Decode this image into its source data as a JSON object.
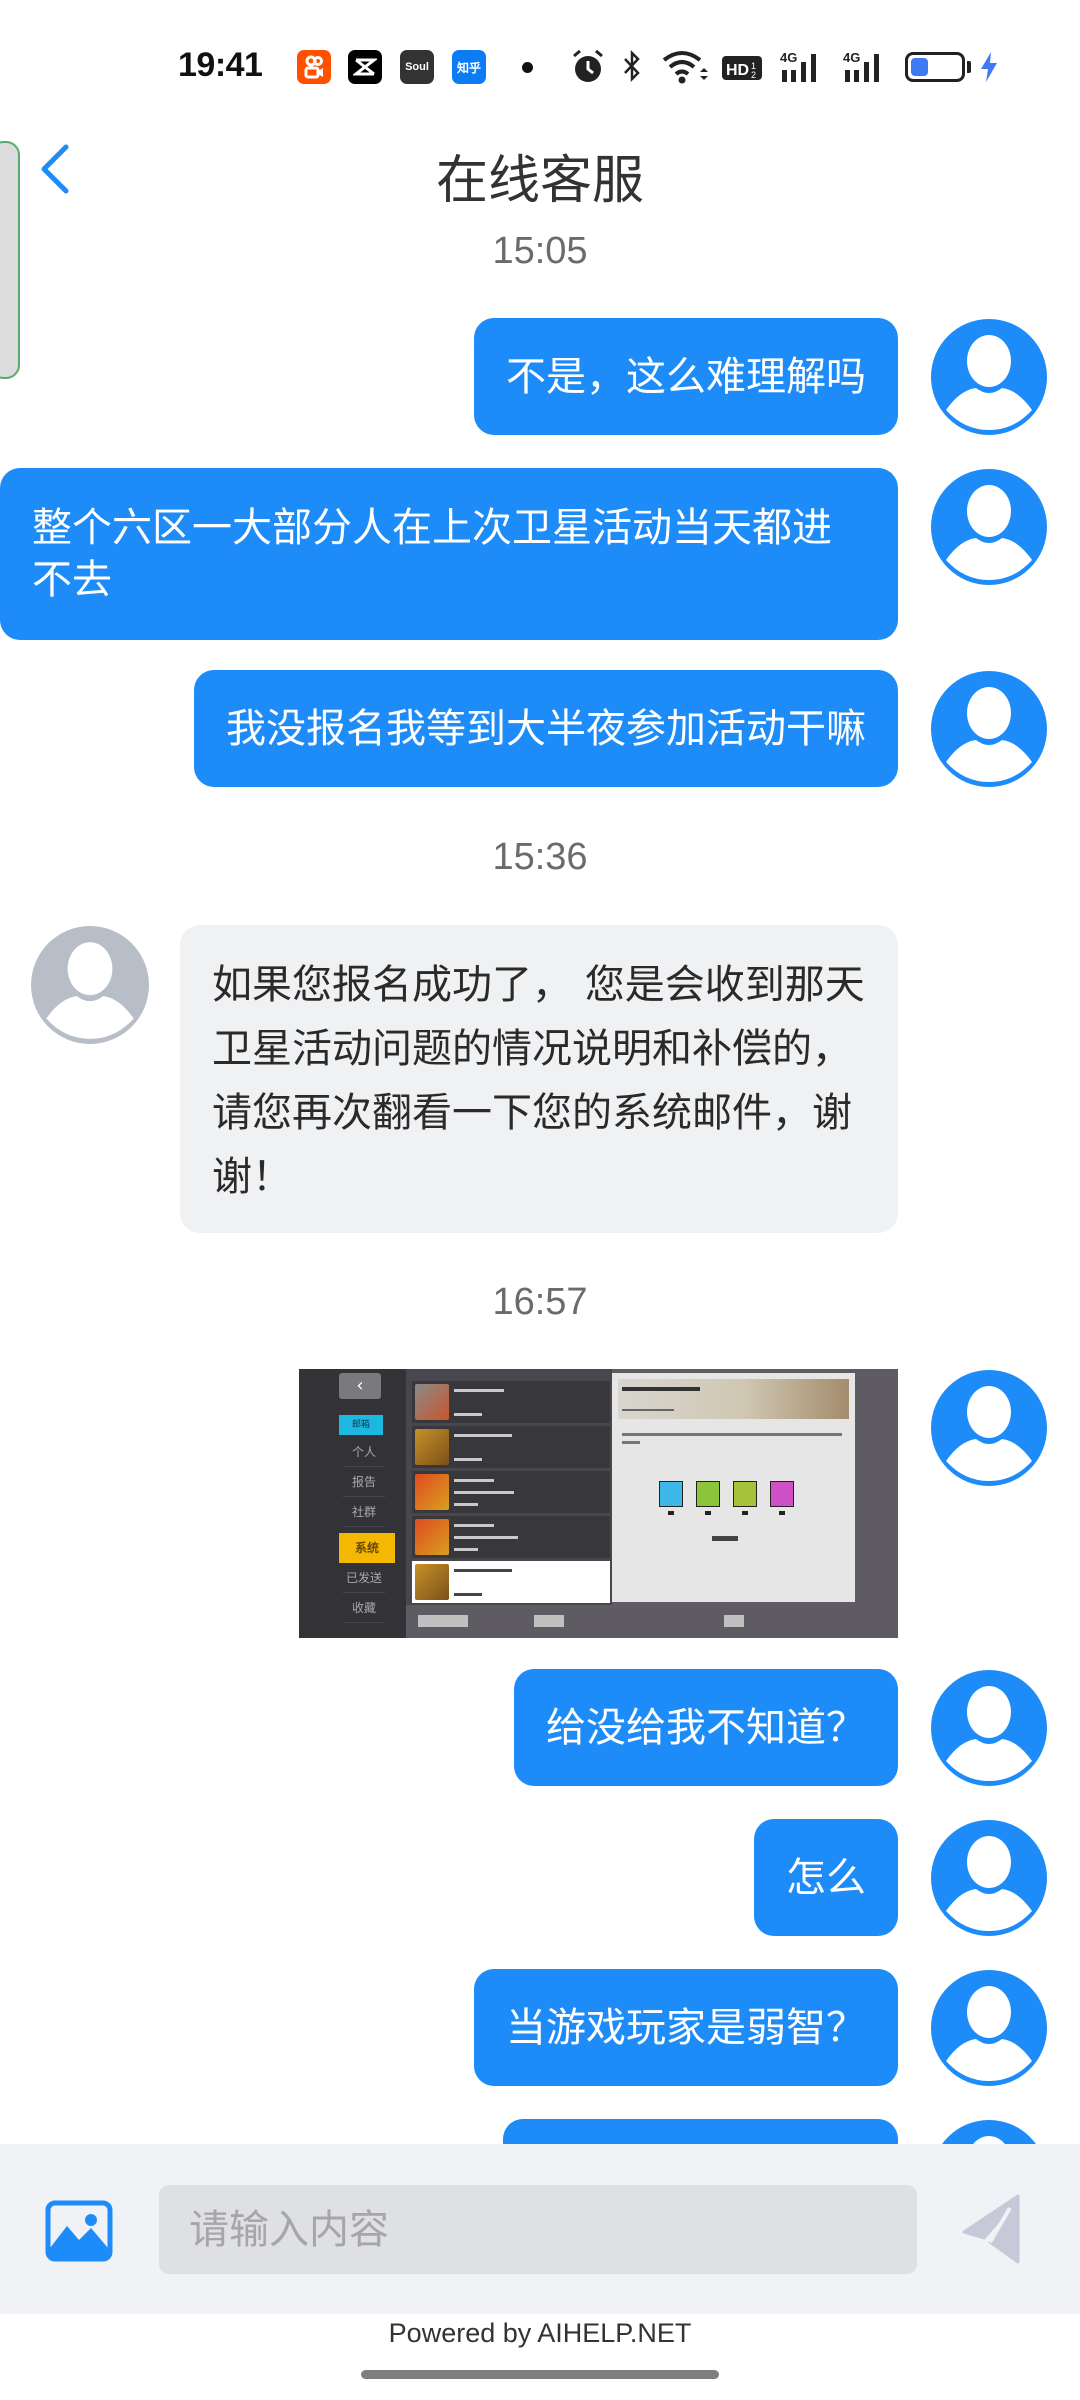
{
  "status_bar": {
    "time": "19:41",
    "apps": [
      {
        "name": "kuaishou",
        "label": "8"
      },
      {
        "name": "capcut",
        "label": "✕"
      },
      {
        "name": "soul",
        "label": "Soul"
      },
      {
        "name": "zhihu",
        "label": "知乎"
      }
    ],
    "icons": [
      "notification-dot",
      "alarm-icon",
      "bluetooth-icon",
      "wifi-icon",
      "hd-icon",
      "signal-4g-icon",
      "signal-4g-icon",
      "battery-icon",
      "charging-icon"
    ],
    "hd_label": "HD",
    "network_label": "4G",
    "battery_level": 0.35,
    "accent": "#3E7BF2"
  },
  "header": {
    "title": "在线客服",
    "back_icon": "chevron-left-icon",
    "accent": "#1E8CF8"
  },
  "conversation": {
    "timestamps": [
      "15:05",
      "15:36",
      "16:57"
    ],
    "messages": [
      {
        "sender": "user",
        "text": "不是，这么难理解吗"
      },
      {
        "sender": "user",
        "text": "整个六区一大部分人在上次卫星活动当天都进不去"
      },
      {
        "sender": "user",
        "text": "我没报名我等到大半夜参加活动干嘛"
      },
      {
        "sender": "agent",
        "text": "如果您报名成功了， 您是会收到那天卫星活动问题的情况说明和补偿的，请您再次翻看一下您的系统邮件，谢谢！"
      },
      {
        "sender": "user",
        "type": "image",
        "alt": "游戏系统邮件截图"
      },
      {
        "sender": "user",
        "text": "给没给我不知道？"
      },
      {
        "sender": "user",
        "text": "怎么"
      },
      {
        "sender": "user",
        "text": "当游戏玩家是弱智？"
      },
      {
        "sender": "user",
        "text": ""
      }
    ],
    "user_bubble_color": "#1E8CF8",
    "agent_bubble_color": "#F0F1F3"
  },
  "screenshot": {
    "back_glyph": "‹",
    "active_tab": "邮箱",
    "nav_items": [
      "个人",
      "报告",
      "社群",
      "系统",
      "已发送",
      "收藏"
    ],
    "selected_nav": "系统",
    "selected_color": "#F5B800"
  },
  "composer": {
    "placeholder": "请输入内容",
    "value": "",
    "image_icon": "image-icon",
    "send_icon": "send-icon"
  },
  "footer": {
    "powered_by": "Powered by AIHELP.NET"
  }
}
